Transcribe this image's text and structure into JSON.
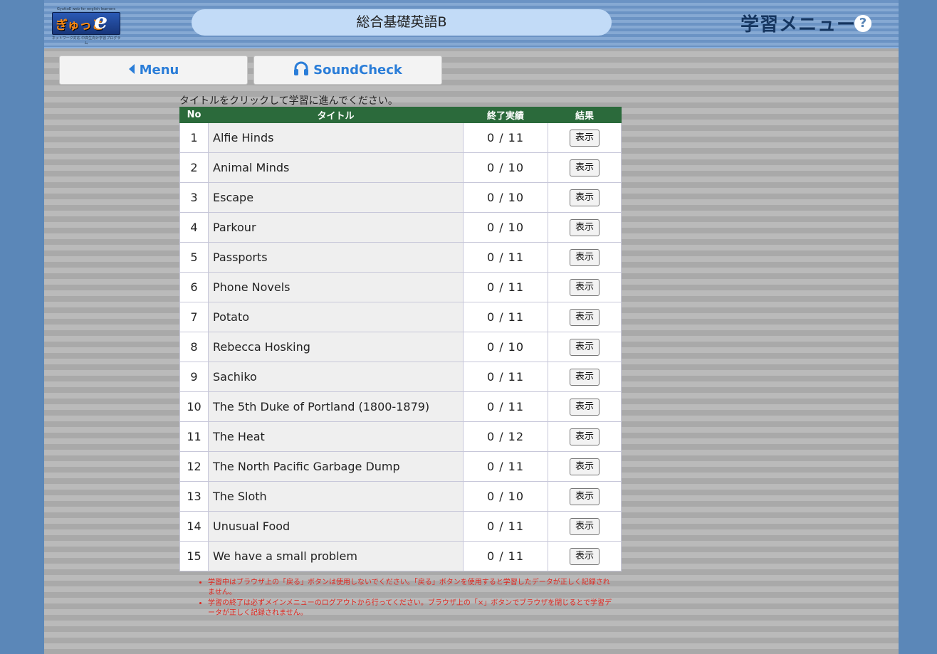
{
  "header": {
    "logo_text": "ぎゅっと",
    "logo_e": "e",
    "logo_sub_top": "GyuttoE  web for english learners",
    "logo_sub_bottom": "ネットワーク対応 中高生向け学習プログラム",
    "course_title": "総合基礎英語B",
    "menu_title": "学習メニュー",
    "help_icon": "question-circle-icon"
  },
  "nav": {
    "menu_label": "Menu",
    "soundcheck_label": "SoundCheck"
  },
  "instruction": "タイトルをクリックして学習に進んでください。",
  "table": {
    "headers": {
      "no": "No",
      "title": "タイトル",
      "score": "終了実績",
      "result": "結果"
    },
    "rows": [
      {
        "no": "1",
        "title": "Alfie Hinds",
        "score": "0 / 11",
        "button": "表示"
      },
      {
        "no": "2",
        "title": "Animal Minds",
        "score": "0 / 10",
        "button": "表示"
      },
      {
        "no": "3",
        "title": "Escape",
        "score": "0 / 10",
        "button": "表示"
      },
      {
        "no": "4",
        "title": "Parkour",
        "score": "0 / 10",
        "button": "表示"
      },
      {
        "no": "5",
        "title": "Passports",
        "score": "0 / 11",
        "button": "表示"
      },
      {
        "no": "6",
        "title": "Phone Novels",
        "score": "0 / 11",
        "button": "表示"
      },
      {
        "no": "7",
        "title": "Potato",
        "score": "0 / 11",
        "button": "表示"
      },
      {
        "no": "8",
        "title": "Rebecca Hosking",
        "score": "0 / 10",
        "button": "表示"
      },
      {
        "no": "9",
        "title": "Sachiko",
        "score": "0 / 11",
        "button": "表示"
      },
      {
        "no": "10",
        "title": "The 5th Duke of Portland (1800-1879)",
        "score": "0 / 11",
        "button": "表示"
      },
      {
        "no": "11",
        "title": "The Heat",
        "score": "0 / 12",
        "button": "表示"
      },
      {
        "no": "12",
        "title": "The North Pacific Garbage Dump",
        "score": "0 / 11",
        "button": "表示"
      },
      {
        "no": "13",
        "title": "The Sloth",
        "score": "0 / 10",
        "button": "表示"
      },
      {
        "no": "14",
        "title": "Unusual Food",
        "score": "0 / 11",
        "button": "表示"
      },
      {
        "no": "15",
        "title": "We have a small problem",
        "score": "0 / 11",
        "button": "表示"
      }
    ]
  },
  "notes": [
    "学習中はブラウザ上の「戻る」ボタンは使用しないでください。「戻る」ボタンを使用すると学習したデータが正しく記録されません。",
    "学習の終了は必ずメインメニューのログアウトから行ってください。ブラウザ上の「×」ボタンでブラウザを閉じるとで学習データが正しく記録されません。"
  ],
  "colors": {
    "background": "#5b87b8",
    "table_header": "#2b6a3b",
    "nav_text": "#2a7dd8",
    "notes_text": "#e0251d",
    "title_pill": "#c2dbf7"
  }
}
